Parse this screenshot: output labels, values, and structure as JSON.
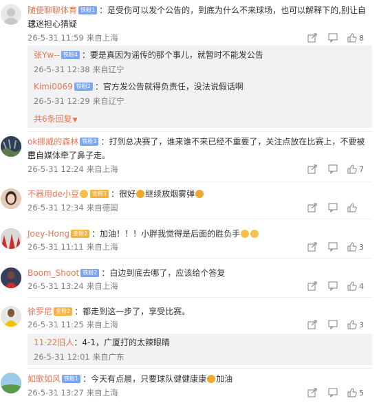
{
  "comments": [
    {
      "user": "随便聊聊体育",
      "badge": "铁粉1",
      "badge_type": "blue",
      "text": "：是受伤可以发个公告的，到底为什么不来球场，也可以解释下的,别让自己",
      "text2": "球迷担心猜疑",
      "date": "26-5-31 11:59",
      "location": "来自上海",
      "likes": "8",
      "replies": [
        {
          "user": "张Yw--",
          "badge": "铁粉4",
          "text": "：要是真因为谣传的那个事儿，就暂时不能发公告",
          "date": "26-5-31 12:38",
          "location": "来自辽宁"
        },
        {
          "user": "Kimi0069",
          "badge": "铁粉2",
          "text": "：官方发公告就得负责任，没法说假话啊",
          "date": "26-5-31 12:29",
          "location": "来自辽宁"
        }
      ],
      "more": "共6条回复"
    },
    {
      "user": "ok挪威的森林",
      "badge": "铁粉3",
      "badge_type": "blue",
      "text": "：打到总决赛了，谁来谁不来已经不重要了，关注点放在比赛上，不要被京",
      "text2": "巴自媒体牵了鼻子走。",
      "date": "26-5-31 12:24",
      "location": "来自上海",
      "likes": "7"
    },
    {
      "user": "不器用de小豆",
      "badge": "金粉3",
      "badge_type": "gold",
      "text": "：很好",
      "text_after": "继续放烟雾弹",
      "date": "26-5-31 12:34",
      "location": "来自德国",
      "likes": ""
    },
    {
      "user": "Joey-Hong",
      "badge": "金粉2",
      "badge_type": "gold",
      "text": "：加油！！！小胖我觉得是后面的胜负手",
      "date": "26-5-31 11:11",
      "location": "来自上海",
      "likes": "3"
    },
    {
      "user": "Boom_Shoot",
      "badge": "铁粉2",
      "badge_type": "blue",
      "text": "：白边到底去哪了，应该给个答复",
      "date": "26-5-31 13:24",
      "location": "来自上海",
      "likes": "4"
    },
    {
      "user": "徐罗尼",
      "badge": "金粉2",
      "badge_type": "gold",
      "text": "：都走到这一步了，享受比赛。",
      "date": "26-5-31 11:25",
      "location": "来自上海",
      "likes": "3",
      "replies": [
        {
          "user": "11·22旧人",
          "badge": "",
          "text": "：4-1，广厦打的太辣眼睛",
          "date": "26-5-31 12:01",
          "location": "来自广东"
        }
      ]
    },
    {
      "user": "如歌如风",
      "badge": "铁粉1",
      "badge_type": "blue",
      "text": "：今天有点晨，只要球队健健康康",
      "text_after": "加油",
      "date": "26-5-31 13:27",
      "location": "来自上海",
      "likes": "5"
    }
  ],
  "colors": {
    "username": "#eb7350",
    "badge_blue": "#7ca6ef",
    "badge_gold": "#f5b23d",
    "reply_bg": "#f2f2f5",
    "meta": "#808080"
  },
  "icons": [
    "share-icon",
    "comment-icon",
    "like-icon",
    "avatar-default-icon"
  ]
}
